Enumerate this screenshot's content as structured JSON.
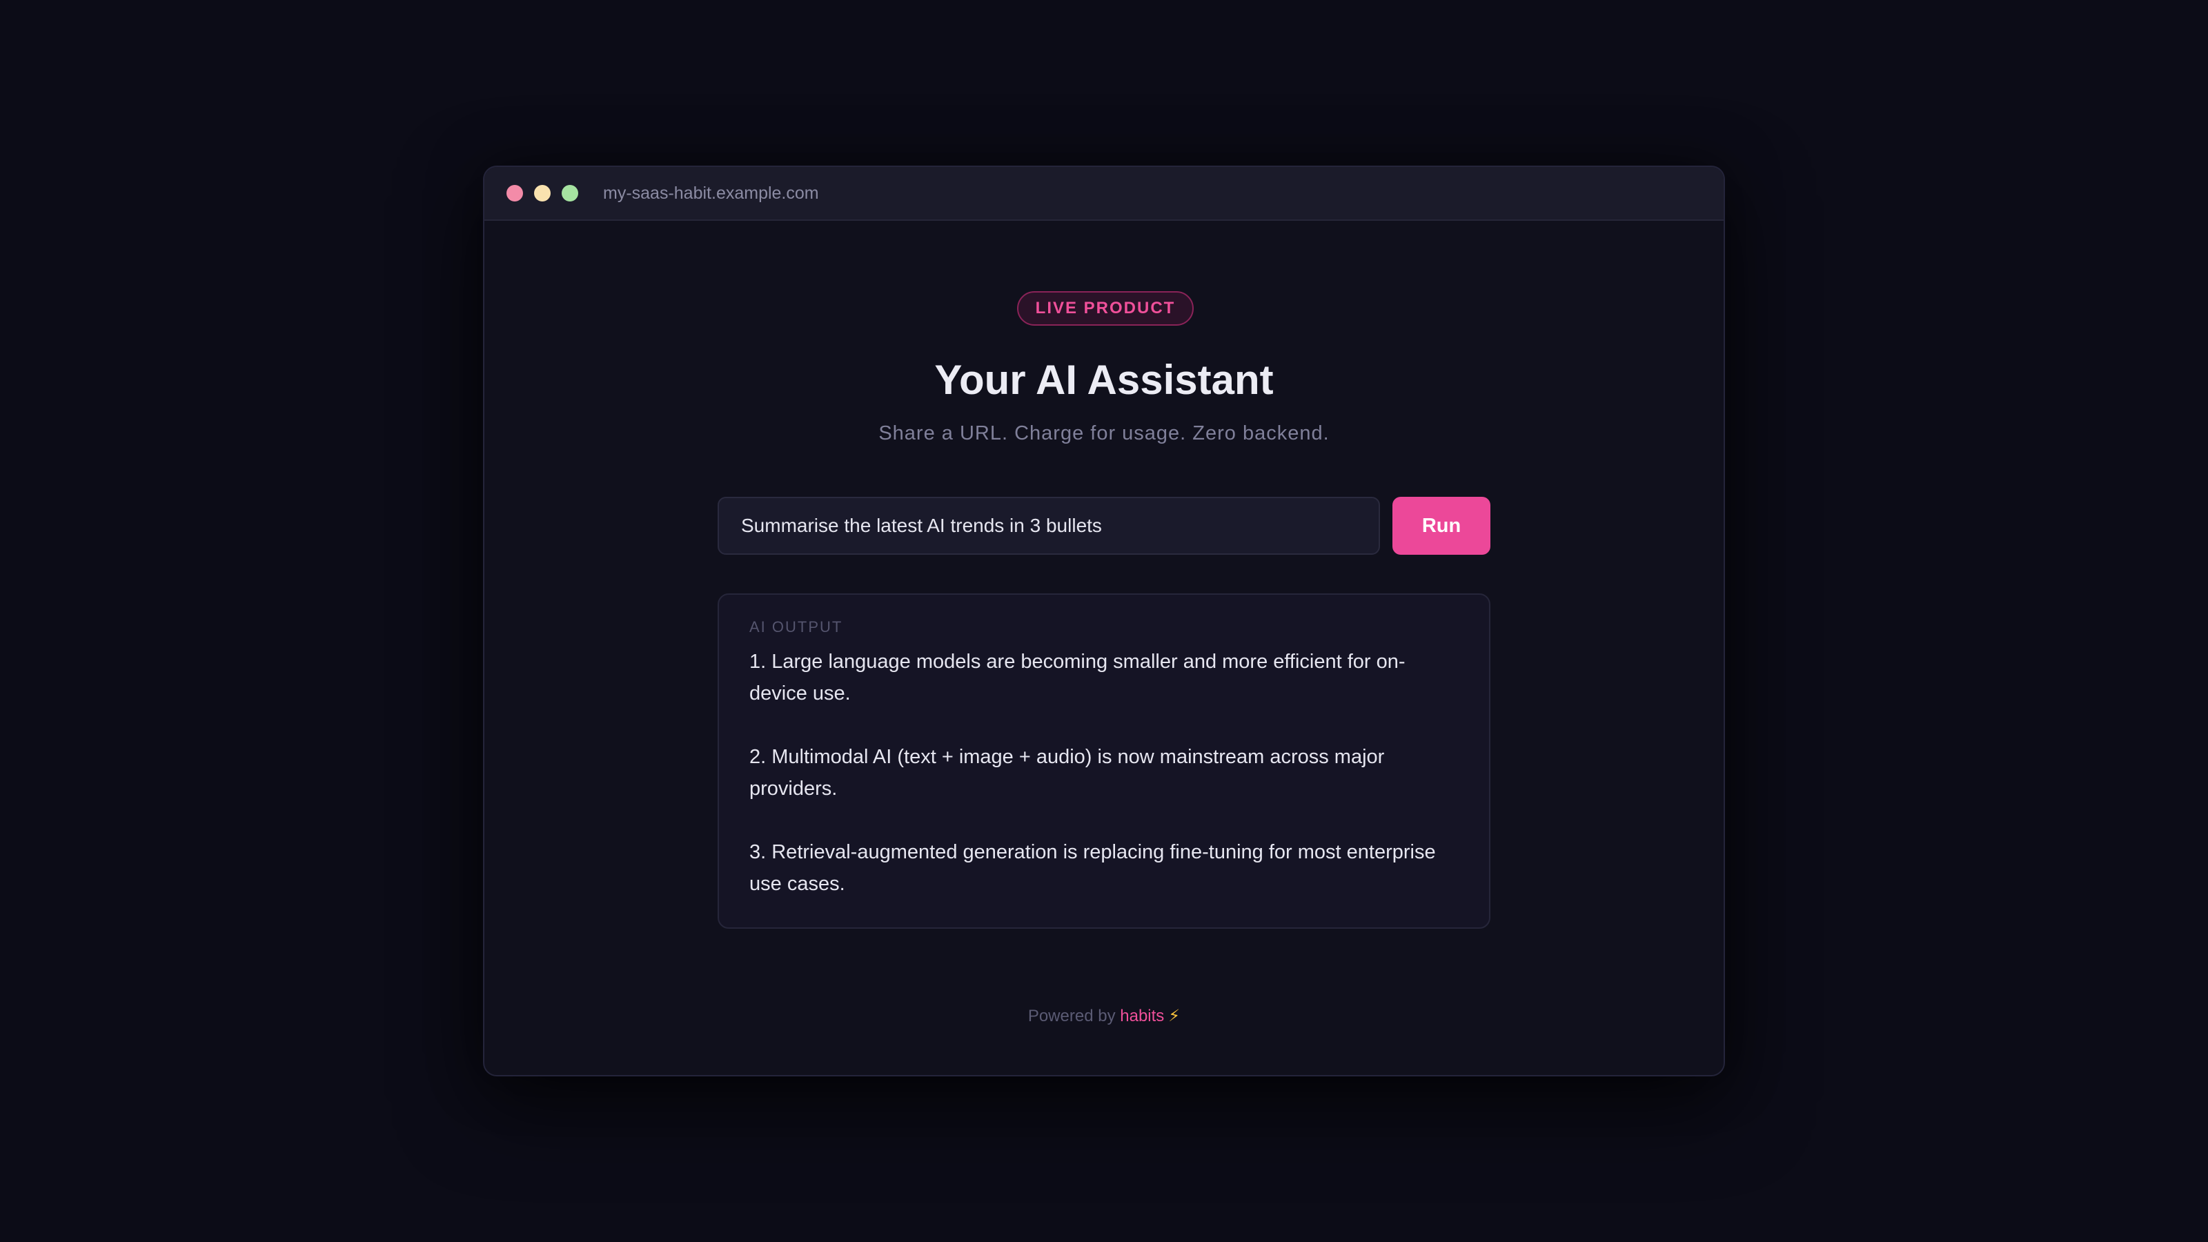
{
  "browser": {
    "url": "my-saas-habit.example.com"
  },
  "badge": "LIVE PRODUCT",
  "hero": {
    "title": "Your AI Assistant",
    "subtitle": "Share a URL. Charge for usage. Zero backend."
  },
  "prompt": {
    "value": "Summarise the latest AI trends in 3 bullets",
    "run_label": "Run"
  },
  "output": {
    "label": "AI OUTPUT",
    "items": [
      "1. Large language models are becoming smaller and more efficient for on-device use.",
      "2. Multimodal AI (text + image + audio) is now mainstream across major providers.",
      "3. Retrieval-augmented generation is replacing fine-tuning for most enterprise use cases."
    ]
  },
  "footer": {
    "prefix": "Powered by",
    "brand": "habits",
    "icon": "⚡"
  },
  "colors": {
    "accent": "#ec4899",
    "background": "#0c0c17",
    "window": "#10101c"
  }
}
